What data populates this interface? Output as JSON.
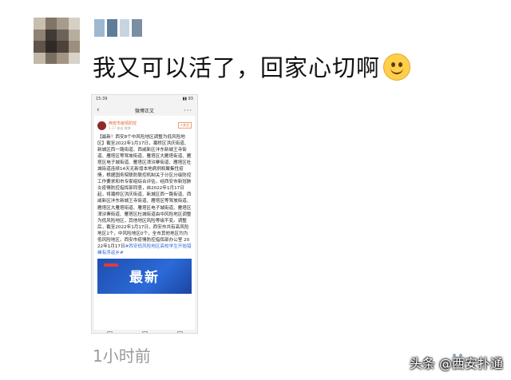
{
  "post": {
    "text": "我又可以活了，回家心切啊",
    "emoji_icon": "smiling-face-emoji",
    "time": "1小时前"
  },
  "screenshot": {
    "status_time": "15:39",
    "status_right": "▮▮ 93",
    "nav_title": "微博正文",
    "account_name": "西安市疫情防控",
    "account_meta": "1-17 来自 微博",
    "follow_label": "+关注",
    "body": "【最新！西安8个中风险地区调整为低风险地区】截至2022年1月17日，灞桥区洪庆街道、新城区西一路街道、西咸新区沣东新城王寺街道、雁塔区等驾坡街道、雁塔区大雁塔街道、雁塔区电子城街道、雁塔区漳浒寨街道、雁塔区杜城街道连续14天无新增本地病例和聚集性疫情，根据国务院联防联控机制关于分区分级防控工作要求和市专家组综合评估，经西安市新冠肺炎疫情防控指挥部同意，自2022年1月17日起，将灞桥区洪庆街道、新城区西一路街道、西咸新区沣东新城王寺街道、雁塔区等驾坡街道、雁塔区大雁塔街道、雁塔区电子城街道、雁塔区漳浒寨街道、雁塔区杜城街道由中风险地区调整为低风险地区，其他地区风险等级不变。调整后，截至2022年1月17日，西安市共有高风险地区1个，中风险地区0个，全市其他地区均为低风险地区。西安市疫情防控指挥部办公室 2022年1月17日",
    "tag_text": "#西安低风险地区高校学生开始错峰有序返乡#",
    "banner_label": "最新"
  },
  "watermark": "头条 @西安扑通",
  "colors": {
    "time_gray": "#9a9a9a",
    "link_blue": "#2c6bd6",
    "brand_orange": "#e0612a"
  }
}
